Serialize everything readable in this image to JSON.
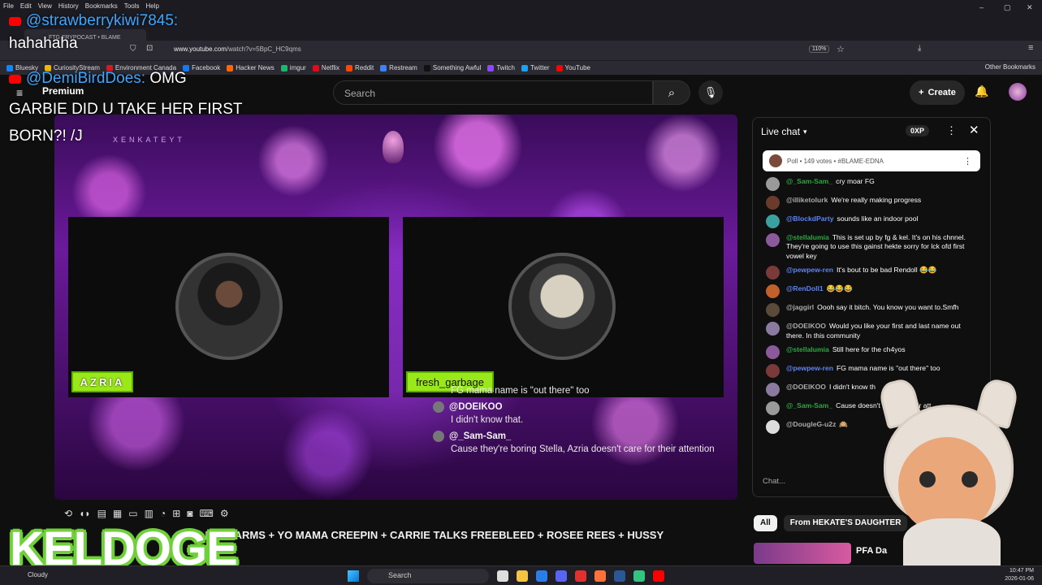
{
  "browser": {
    "menu": [
      "File",
      "Edit",
      "View",
      "History",
      "Bookmarks",
      "Tools",
      "Help"
    ],
    "tab_title": "FTG FRYPOCAST • BLAME",
    "url_host": "www.youtube.com",
    "url_path": "/watch?v=5BpC_HC9qms",
    "zoom": "110%",
    "bookmarks": [
      {
        "label": "Bluesky",
        "color": "#1185fe"
      },
      {
        "label": "CuriosityStream",
        "color": "#f2b705"
      },
      {
        "label": "Environment Canada",
        "color": "#d71920"
      },
      {
        "label": "Facebook",
        "color": "#1877f2"
      },
      {
        "label": "Hacker News",
        "color": "#ff6600"
      },
      {
        "label": "imgur",
        "color": "#1bb76e"
      },
      {
        "label": "Netflix",
        "color": "#e50914"
      },
      {
        "label": "Reddit",
        "color": "#ff4500"
      },
      {
        "label": "Restream",
        "color": "#3b82f6"
      },
      {
        "label": "Something Awful",
        "color": "#111111"
      },
      {
        "label": "Twitch",
        "color": "#9146ff"
      },
      {
        "label": "Twitter",
        "color": "#1da1f2"
      },
      {
        "label": "YouTube",
        "color": "#ff0000"
      }
    ],
    "other_bookmarks": "Other Bookmarks"
  },
  "youtube": {
    "premium_label": "Premium",
    "search_placeholder": "Search",
    "create_label": "Create"
  },
  "overlay": {
    "msg1_user": "@strawberrykiwi7845:",
    "msg1_text": "hahahaha",
    "msg2_user": "@DemiBirdDoes:",
    "msg2_text_a": "OMG",
    "msg2_text_b": "GARBIE DID U TAKE HER FIRST BORN?! /J",
    "brand": "KELDOGE"
  },
  "player": {
    "header_text": "XENKATEYT",
    "left_name": "AZRIA",
    "right_name": "fresh_garbage",
    "overlay_messages": [
      {
        "user": "FG mama name is \"out there\" too",
        "text": ""
      },
      {
        "user": "@DOEIKOO",
        "text": "I didn't know that."
      },
      {
        "user": "@_Sam-Sam_",
        "text": "Cause they're boring Stella, Azria doesn't care for their attention"
      }
    ]
  },
  "video": {
    "title": "A KIWIFARMS + YO MAMA CREEPIN + CARRIE TALKS FREEBLEED + ROSEE REES + HUSSY"
  },
  "chat": {
    "header": "Live chat",
    "xp": "0XP",
    "poll_text": "Poll • 149 votes • #BLAME-EDNA",
    "input_placeholder": "Chat...",
    "messages": [
      {
        "user": "@_Sam-Sam_",
        "text": "cry moar FG",
        "style": "green",
        "avatar": "#9a9a9a"
      },
      {
        "user": "@illiketolurk",
        "text": "We're really making progress",
        "style": "",
        "avatar": "#6a3a2a"
      },
      {
        "user": "@BlockdParty",
        "text": "sounds like an indoor pool",
        "style": "blue",
        "avatar": "#3aa0a0"
      },
      {
        "user": "@stellalumia",
        "text": "This is set up by fg & kel. It's on his chnnel. They're going to use this gainst hekte sorry for lck ofd first vowel key",
        "style": "green",
        "avatar": "#8a5a9a"
      },
      {
        "user": "@pewpew-ren",
        "text": "It's bout to be bad Rendoll 😂😂",
        "style": "blue",
        "avatar": "#7a3a3a"
      },
      {
        "user": "@RenDoll1",
        "text": "😂😂😂",
        "style": "blue",
        "avatar": "#c0602a"
      },
      {
        "user": "@jaggirl",
        "text": "Oooh say it bitch. You know you want to.Smfh",
        "style": "",
        "avatar": "#5a4a3a"
      },
      {
        "user": "@DOEIKOO",
        "text": "Would you like your first and last name out there. In this community",
        "style": "",
        "avatar": "#8a7aa0"
      },
      {
        "user": "@stellalumia",
        "text": "Still here for the ch4yos",
        "style": "green",
        "avatar": "#8a5a9a"
      },
      {
        "user": "@pewpew-ren",
        "text": "FG mama name is \"out there\" too",
        "style": "blue",
        "avatar": "#7a3a3a"
      },
      {
        "user": "@DOEIKOO",
        "text": "I didn't know th",
        "style": "",
        "avatar": "#8a7aa0"
      },
      {
        "user": "@_Sam-Sam_",
        "text": "Cause doesn't care for their att",
        "style": "green",
        "avatar": "#9a9a9a"
      },
      {
        "user": "@DougleG-u2z",
        "text": "🙉",
        "style": "",
        "avatar": "#dddddd"
      }
    ],
    "chips": [
      "All",
      "From HEKATE'S DAUGHTER"
    ],
    "related_text": "PFA Da"
  },
  "taskbar": {
    "weather": "Cloudy",
    "search": "Search",
    "time": "10:47 PM",
    "date": "2026-01-06"
  }
}
